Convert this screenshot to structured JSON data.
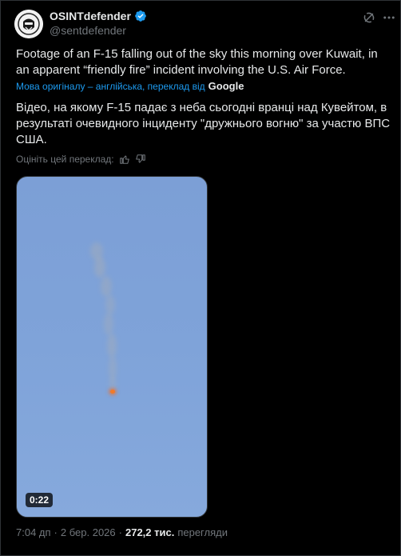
{
  "author": {
    "display_name": "OSINTdefender",
    "handle": "@sentdefender",
    "verified": true
  },
  "tweet": {
    "text": "Footage of an F-15 falling out of the sky this morning over Kuwait, in an apparent “friendly fire” incident involving the U.S. Air Force.",
    "translation_note": "Мова оригіналу – англійська, переклад від",
    "translation_provider": "Google",
    "translated_text": "Відео, на якому F-15 падає з неба сьогодні вранці над Кувейтом, в результаті очевидного інциденту \"дружнього вогню\" за участю ВПС США.",
    "rate_label": "Оцініть цей переклад:"
  },
  "media": {
    "duration": "0:22"
  },
  "meta": {
    "time": "7:04 дп",
    "date": "2 бер. 2026",
    "views_count": "272,2 тис.",
    "views_label": "перегляди",
    "separator": "·"
  },
  "icons": {
    "verified": "verified-badge-icon",
    "grok": "grok-icon",
    "more": "more-icon",
    "thumb_up": "thumbs-up-icon",
    "thumb_down": "thumbs-down-icon"
  },
  "colors": {
    "background": "#000000",
    "text": "#e7e9ea",
    "secondary": "#71767b",
    "accent": "#1d9bf0",
    "border": "#2f3336"
  }
}
